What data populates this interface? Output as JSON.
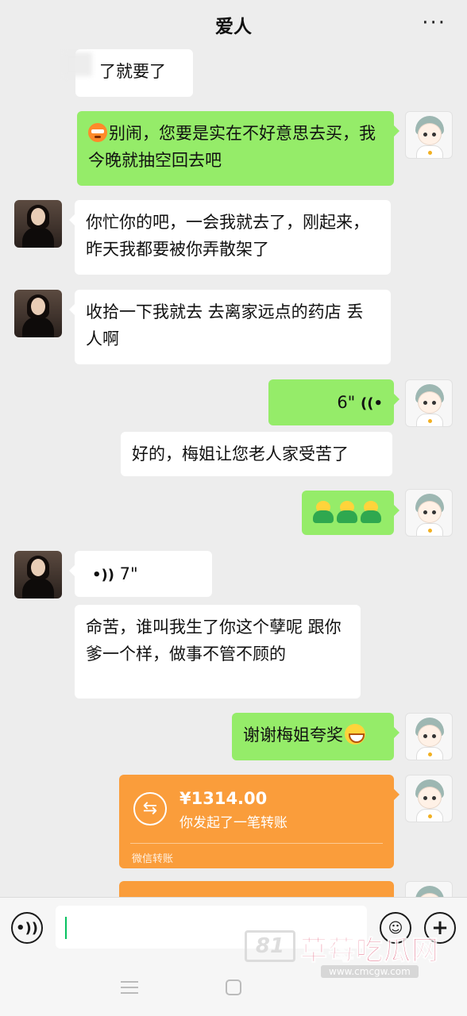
{
  "header": {
    "title": "爱人",
    "more": "···"
  },
  "messages": {
    "m0": "了就要了",
    "m1": "别闹，您要是实在不好意思去买，我今晚就抽空回去吧",
    "m2": "你忙你的吧，一会我就去了，刚起来，昨天我都要被你弄散架了",
    "m3": "收拾一下我就去 去离家远点的药店 丢人啊",
    "m4_voice": "6\"",
    "m5": "好的，梅姐让您老人家受苦了",
    "m7_voice": "7\"",
    "m8": "命苦，谁叫我生了你这个孽呢 跟你爹一个样，做事不管不顾的",
    "m9": "谢谢梅姐夸奖"
  },
  "transfer": {
    "amount": "¥1314.00",
    "desc": "你发起了一笔转账",
    "source": "微信转账",
    "icon": "transfer-arrows-icon"
  },
  "input": {
    "value": ""
  },
  "icons": {
    "voice": "voice-input-icon",
    "emoji": "emoji-icon",
    "plus": "plus-icon"
  },
  "watermark": {
    "logo": "81",
    "name": "草莓吃瓜网",
    "url": "www.cmcgw.com"
  },
  "colors": {
    "bg": "#ededed",
    "self_bubble": "#95ec69",
    "other_bubble": "#ffffff",
    "transfer": "#fa9d3b"
  }
}
